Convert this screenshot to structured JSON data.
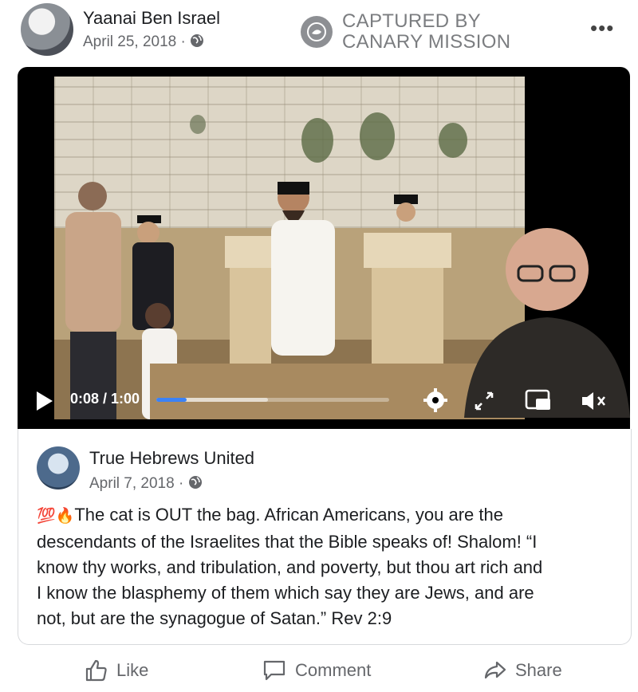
{
  "post": {
    "author": "Yaanai Ben Israel",
    "date": "April 25, 2018 ·",
    "badge_line1": "CAPTURED BY",
    "badge_line2": "CANARY MISSION",
    "more_icon": "•••"
  },
  "video": {
    "time": "0:08 / 1:00",
    "progress": 0.13,
    "buffered": 0.48
  },
  "shared_post": {
    "author": "True Hebrews United",
    "date": "April 7, 2018 ·",
    "emoji": "💯🔥",
    "text_lines": [
      "The cat is OUT the bag. African Americans, you are the",
      "descendants of the Israelites that the Bible speaks of! Shalom! “I",
      "know thy works, and tribulation, and poverty, but thou art rich and",
      "I know the blasphemy of them which say they are Jews, and are",
      "not, but are the synagogue of Satan.” Rev 2:9"
    ]
  },
  "actions": {
    "like": "Like",
    "comment": "Comment",
    "share": "Share"
  },
  "colors": {
    "progress": "#3b82f6",
    "secondary_text": "#65676b",
    "badge_gray": "#8d8f93"
  }
}
